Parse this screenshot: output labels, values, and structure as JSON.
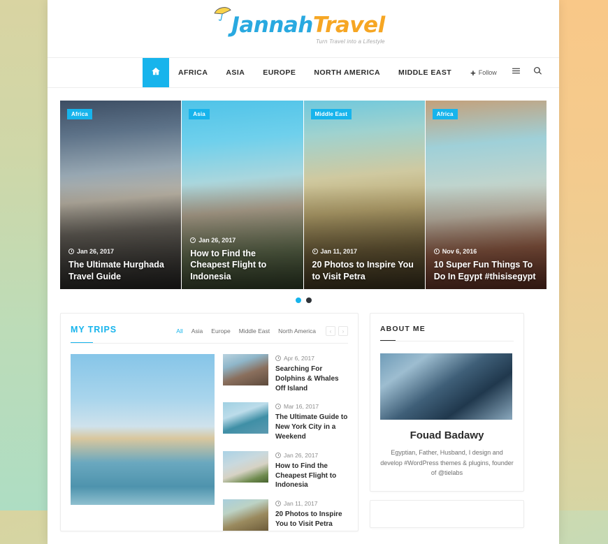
{
  "site": {
    "logo_primary": "Jannah",
    "logo_secondary": "Travel",
    "tagline": "Turn Travel into a Lifestyle",
    "accent_color": "#17b4ec",
    "logo_primary_color": "#29a9e0",
    "logo_secondary_color": "#f6a623"
  },
  "nav": {
    "home_icon": "home-icon",
    "items": [
      {
        "label": "AFRICA"
      },
      {
        "label": "ASIA"
      },
      {
        "label": "EUROPE"
      },
      {
        "label": "NORTH AMERICA"
      },
      {
        "label": "MIDDLE EAST"
      }
    ],
    "follow": {
      "plus": "+",
      "label": "Follow"
    },
    "menu_icon": "hamburger-menu-icon",
    "search_icon": "search-icon"
  },
  "slider": {
    "slides": [
      {
        "category": "Africa",
        "date": "Jan 26, 2017",
        "title": "The Ultimate Hurghada Travel Guide"
      },
      {
        "category": "Asia",
        "date": "Jan 26, 2017",
        "title": "How to Find the Cheapest Flight to Indonesia"
      },
      {
        "category": "Middle East",
        "date": "Jan 11, 2017",
        "title": "20 Photos to Inspire You to Visit Petra"
      },
      {
        "category": "Africa",
        "date": "Nov 6, 2016",
        "title": "10 Super Fun Things To Do In Egypt #thisisegypt"
      }
    ],
    "dots": [
      {
        "active": true
      },
      {
        "active": false
      }
    ]
  },
  "trips": {
    "title": "MY TRIPS",
    "filters": [
      {
        "label": "All",
        "active": true
      },
      {
        "label": "Asia",
        "active": false
      },
      {
        "label": "Europe",
        "active": false
      },
      {
        "label": "Middle East",
        "active": false
      },
      {
        "label": "North America",
        "active": false
      }
    ],
    "prev_arrow": "‹",
    "next_arrow": "›",
    "items": [
      {
        "date": "Apr 6, 2017",
        "title": "Searching For Dolphins & Whales Off Island"
      },
      {
        "date": "Mar 16, 2017",
        "title": "The Ultimate Guide to New York City in a Weekend"
      },
      {
        "date": "Jan 26, 2017",
        "title": "How to Find the Cheapest Flight to Indonesia"
      },
      {
        "date": "Jan 11, 2017",
        "title": "20 Photos to Inspire You to Visit Petra"
      }
    ]
  },
  "about": {
    "title": "ABOUT ME",
    "name": "Fouad Badawy",
    "bio": "Egyptian, Father, Husband, I design and develop #WordPress themes & plugins, founder of @tielabs"
  }
}
